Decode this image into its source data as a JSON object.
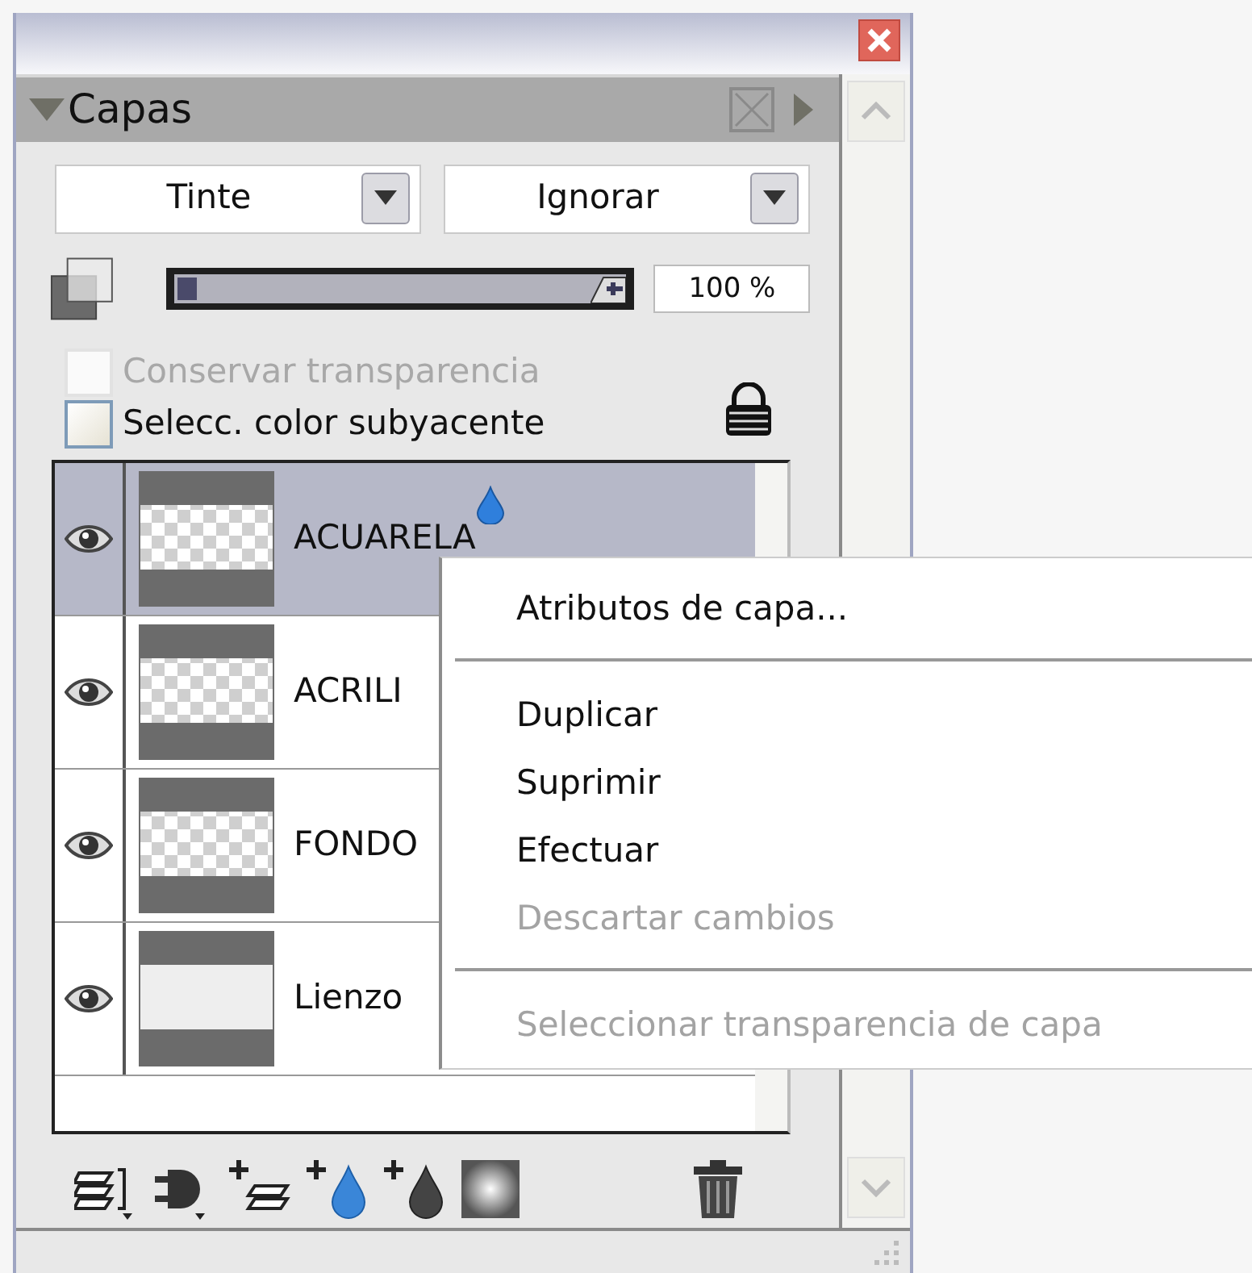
{
  "panel": {
    "title": "Capas",
    "dropdowns": [
      {
        "value": "Tinte"
      },
      {
        "value": "Ignorar"
      }
    ],
    "opacity": {
      "level": 1,
      "reading": "100 %"
    },
    "checkboxes": [
      {
        "label": "Conservar transparencia",
        "checked": false,
        "disabled": true
      },
      {
        "label": "Selecc. color subyacente",
        "checked": false,
        "disabled": false
      }
    ],
    "layers": [
      {
        "name": "ACUARELA",
        "selected": true,
        "visible": true,
        "kind": "transparent",
        "watercolor": true
      },
      {
        "name": "ACRILI",
        "selected": false,
        "visible": true,
        "kind": "transparent"
      },
      {
        "name": "FONDO",
        "selected": false,
        "visible": true,
        "kind": "transparent"
      },
      {
        "name": "Lienzo",
        "selected": false,
        "visible": true,
        "kind": "canvas"
      }
    ]
  },
  "context_menu": [
    {
      "kind": "item",
      "label": "Atributos de capa...",
      "disabled": false
    },
    {
      "kind": "separator"
    },
    {
      "kind": "item",
      "label": "Duplicar",
      "disabled": false
    },
    {
      "kind": "item",
      "label": "Suprimir",
      "disabled": false
    },
    {
      "kind": "item",
      "label": "Efectuar",
      "disabled": false
    },
    {
      "kind": "item",
      "label": "Descartar cambios",
      "disabled": true
    },
    {
      "kind": "separator"
    },
    {
      "kind": "item",
      "label": "Seleccionar transparencia de capa",
      "disabled": true
    }
  ]
}
